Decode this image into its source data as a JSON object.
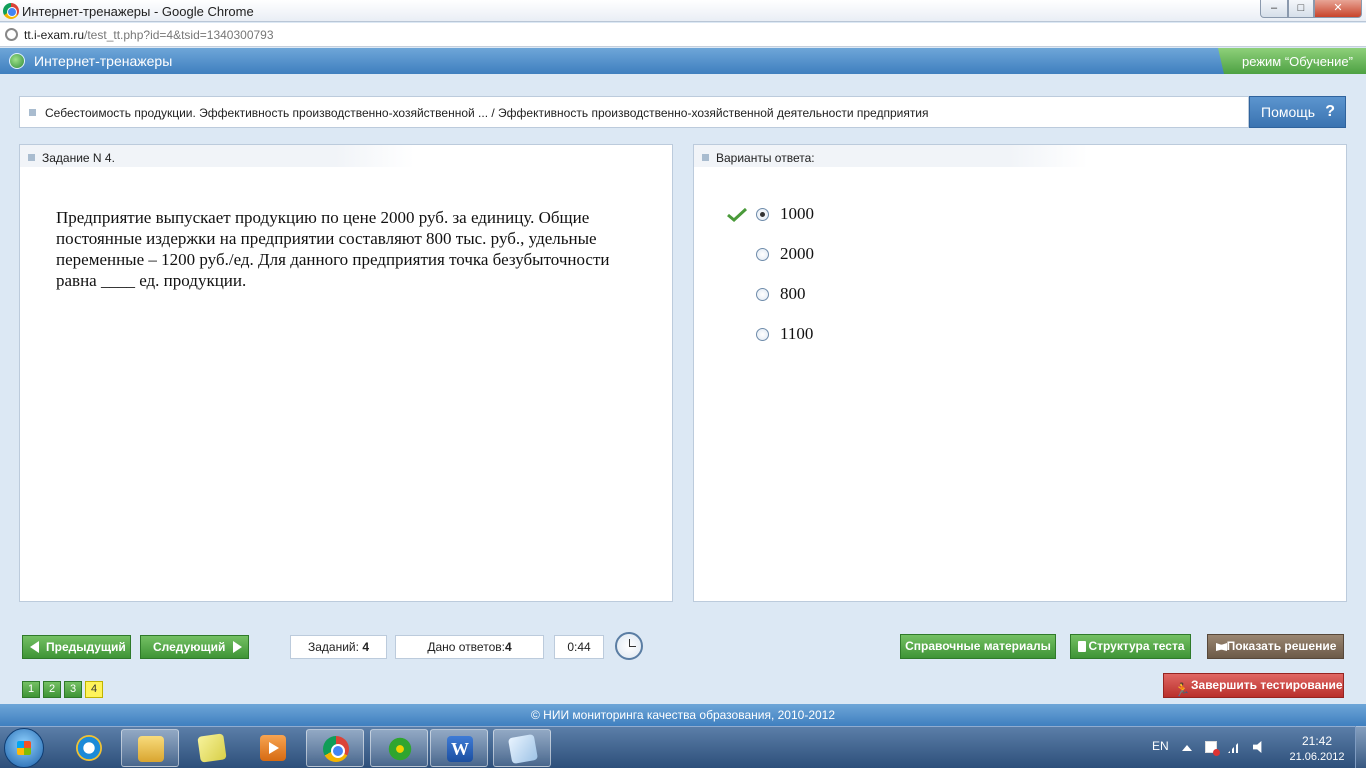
{
  "window": {
    "title": "Интернет-тренажеры - Google Chrome",
    "min_glyph": "–",
    "max_glyph": "□",
    "close_glyph": "✕"
  },
  "address": {
    "host": "tt.i-exam.ru",
    "path": "/test_tt.php?id=4&tsid=1340300793"
  },
  "app": {
    "name": "Интернет-тренажеры",
    "mode": "режим “Обучение”"
  },
  "breadcrumb": {
    "text": "Себестоимость продукции. Эффективность производственно-хозяйственной ... / Эффективность производственно-хозяйственной деятельности предприятия"
  },
  "help": {
    "label": "Помощь",
    "icon_glyph": "?"
  },
  "task": {
    "header": "Задание N 4.",
    "question": "Предприятие выпускает продукцию по цене 2000 руб. за единицу. Общие постоянные издержки на предприятии составляют 800 тыс. руб., удельные переменные – 1200 руб./ед. Для данного предприятия точка безубыточности равна ____ ед. продукции."
  },
  "answers": {
    "header": "Варианты ответа:",
    "options": [
      {
        "value": "1000",
        "selected": true,
        "correct_mark": true
      },
      {
        "value": "2000",
        "selected": false,
        "correct_mark": false
      },
      {
        "value": "800",
        "selected": false,
        "correct_mark": false
      },
      {
        "value": "1100",
        "selected": false,
        "correct_mark": false
      }
    ]
  },
  "toolbar": {
    "prev_label": "Предыдущий",
    "next_label": "Следующий",
    "tasks_label": "Заданий:",
    "tasks_count": "4",
    "answers_label": "Дано ответов:",
    "answers_count": "4",
    "timer": "0:44",
    "ref_label": "Справочные материалы",
    "struct_label": "Структура теста",
    "solution_label": "Показать решение",
    "finish_label": "Завершить тестирование",
    "pages": [
      "1",
      "2",
      "3",
      "4"
    ],
    "current_page": "4"
  },
  "footer": {
    "text": "© НИИ мониторинга качества образования, 2010-2012"
  },
  "taskbar": {
    "lang": "EN",
    "time": "21:42",
    "date": "21.06.2012",
    "word_glyph": "W",
    "apps": [
      "start-icon",
      "internet-explorer-icon",
      "file-explorer-icon",
      "sticky-notes-icon",
      "media-player-icon",
      "chrome-icon",
      "icq-icon",
      "word-icon",
      "notepad-icon"
    ]
  },
  "colors": {
    "header_blue": "#3f7fbf",
    "button_green": "#3e9436",
    "finish_red": "#b92f2b",
    "solution_brown": "#6c5a48",
    "current_page_yellow": "#fff35a"
  }
}
